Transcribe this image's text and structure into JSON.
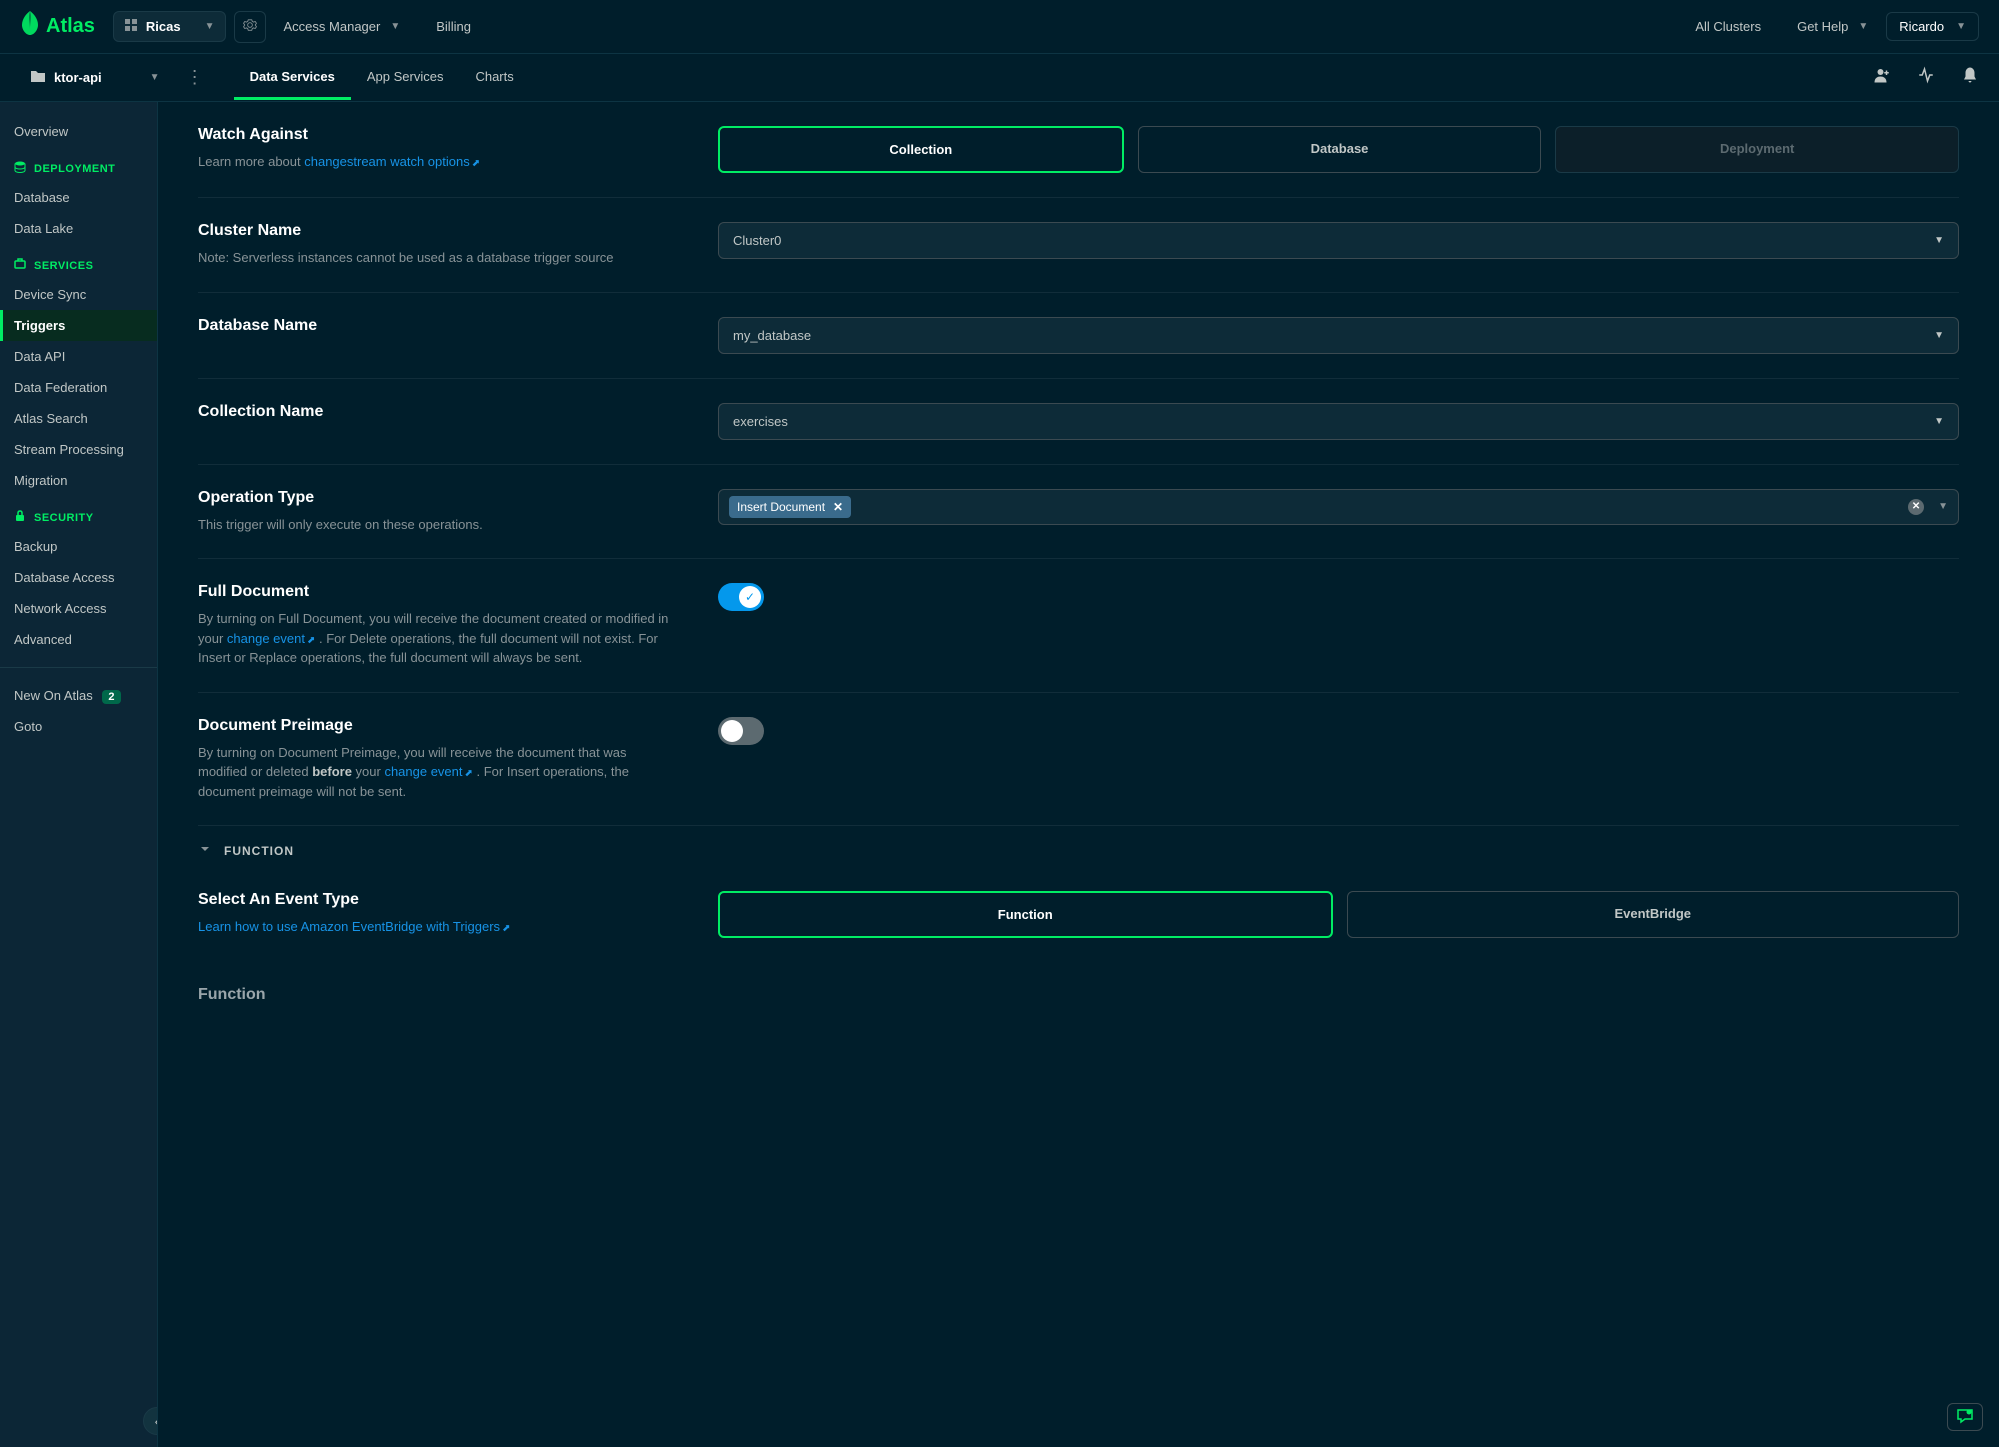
{
  "brand": "Atlas",
  "topnav": {
    "org_name": "Ricas",
    "links": {
      "access_manager": "Access Manager",
      "billing": "Billing",
      "all_clusters": "All Clusters",
      "get_help": "Get Help"
    },
    "user": "Ricardo"
  },
  "subnav": {
    "project_name": "ktor-api",
    "tabs": {
      "data_services": "Data Services",
      "app_services": "App Services",
      "charts": "Charts"
    }
  },
  "sidebar": {
    "overview": "Overview",
    "sections": {
      "deployment": "DEPLOYMENT",
      "services": "SERVICES",
      "security": "SECURITY"
    },
    "items": {
      "database": "Database",
      "data_lake": "Data Lake",
      "device_sync": "Device Sync",
      "triggers": "Triggers",
      "data_api": "Data API",
      "data_federation": "Data Federation",
      "atlas_search": "Atlas Search",
      "stream_processing": "Stream Processing",
      "migration": "Migration",
      "backup": "Backup",
      "database_access": "Database Access",
      "network_access": "Network Access",
      "advanced": "Advanced",
      "new_on_atlas": "New On Atlas",
      "new_badge": "2",
      "goto": "Goto"
    }
  },
  "form": {
    "watch_against": {
      "title": "Watch Against",
      "desc_prefix": "Learn more about ",
      "link": "changestream watch options",
      "options": {
        "collection": "Collection",
        "database": "Database",
        "deployment": "Deployment"
      }
    },
    "cluster_name": {
      "title": "Cluster Name",
      "note": "Note: Serverless instances cannot be used as a database trigger source",
      "value": "Cluster0"
    },
    "database_name": {
      "title": "Database Name",
      "value": "my_database"
    },
    "collection_name": {
      "title": "Collection Name",
      "value": "exercises"
    },
    "operation_type": {
      "title": "Operation Type",
      "desc": "This trigger will only execute on these operations.",
      "tag": "Insert Document"
    },
    "full_document": {
      "title": "Full Document",
      "desc_1": "By turning on Full Document, you will receive the document created or modified in your ",
      "link": "change event",
      "desc_2": " . For Delete operations, the full document will not exist. For Insert or Replace operations, the full document will always be sent."
    },
    "document_preimage": {
      "title": "Document Preimage",
      "desc_1": "By turning on Document Preimage, you will receive the document that was modified or deleted ",
      "bold": "before",
      "desc_2": " your ",
      "link": "change event",
      "desc_3": " . For Insert operations, the document preimage will not be sent."
    },
    "function_section": "FUNCTION",
    "event_type": {
      "title": "Select An Event Type",
      "link": "Learn how to use Amazon EventBridge with Triggers",
      "options": {
        "function": "Function",
        "eventbridge": "EventBridge"
      }
    },
    "function_label": "Function"
  }
}
